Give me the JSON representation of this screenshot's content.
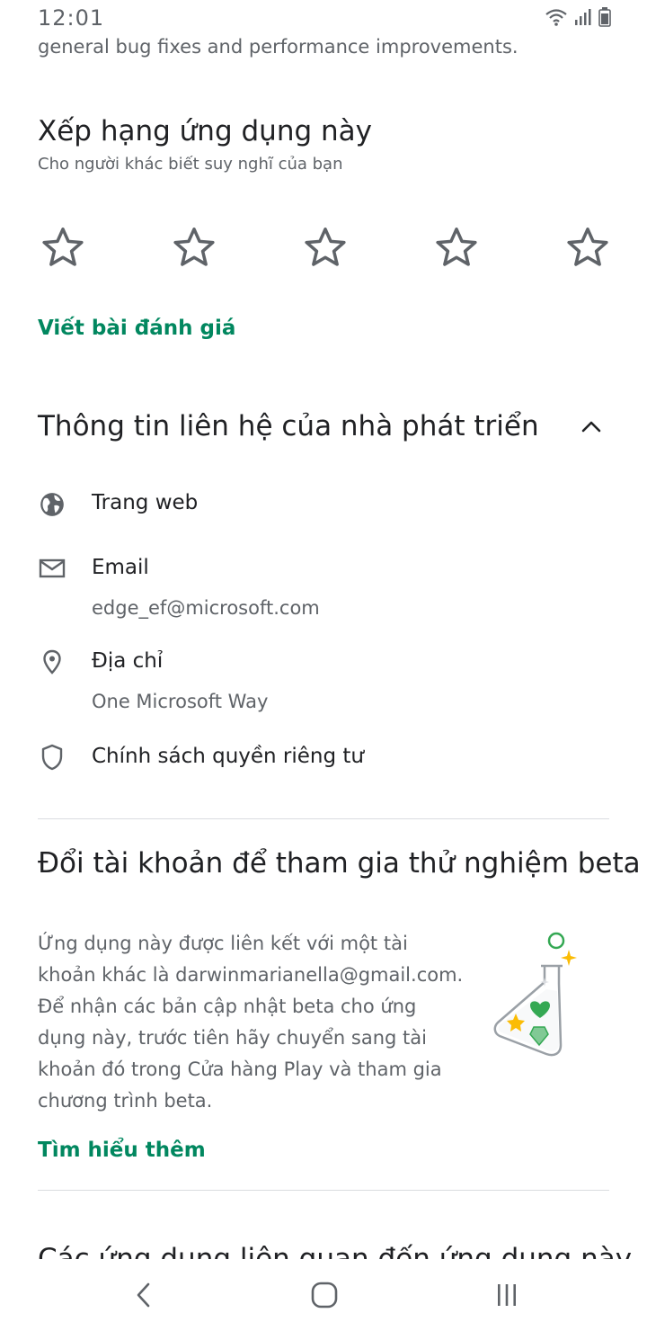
{
  "status_bar": {
    "time": "12:01"
  },
  "top_cut_text": "general bug fixes and performance improvements.",
  "rate": {
    "title": "Xếp hạng ứng dụng này",
    "subtitle": "Cho người khác biết suy nghĩ của bạn",
    "stars_total": 5,
    "stars_selected": 0,
    "write_review": "Viết bài đánh giá"
  },
  "developer": {
    "title": "Thông tin liên hệ của nhà phát triển",
    "website_label": "Trang web",
    "email_label": "Email",
    "email_value": "edge_ef@microsoft.com",
    "address_label": "Địa chỉ",
    "address_value": "One Microsoft Way",
    "privacy_label": "Chính sách quyền riêng tư"
  },
  "beta": {
    "title": "Đổi tài khoản để tham gia thử nghiệm beta",
    "lines": [
      "Ứng dụng này được liên kết với một tài",
      "khoản khác là darwinmarianella@gmail.com.",
      "Để nhận các bản cập nhật beta cho ứng",
      "dụng này, trước tiên hãy chuyển sang tài",
      "khoản đó trong Cửa hàng Play và tham gia",
      "chương trình beta."
    ],
    "learn_more": "Tìm hiểu thêm"
  },
  "next_section_peek": "Các ứng dụng liên quan đến ứng dụng này",
  "colors": {
    "accent_green": "#01875f",
    "text_primary": "#202124",
    "text_secondary": "#5f6368"
  }
}
